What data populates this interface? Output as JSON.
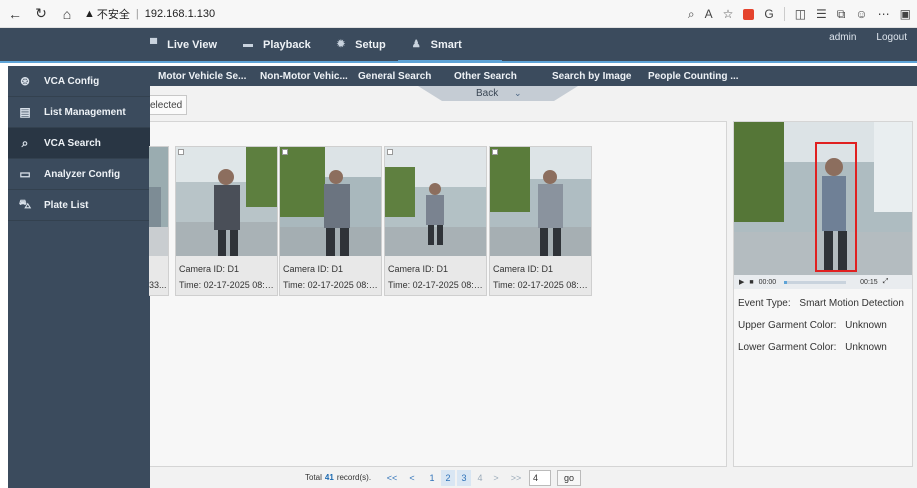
{
  "browser": {
    "security_warning": "不安全",
    "url": "192.168.1.130"
  },
  "header": {
    "menu": [
      {
        "label": "Live View",
        "icon": "monitor-icon"
      },
      {
        "label": "Playback",
        "icon": "film-icon"
      },
      {
        "label": "Setup",
        "icon": "gear-icon"
      },
      {
        "label": "Smart",
        "icon": "person-icon",
        "active": true
      }
    ],
    "user": "admin",
    "logout": "Logout"
  },
  "sidebar": {
    "items": [
      {
        "label": "VCA Config",
        "icon": "vca-config-icon"
      },
      {
        "label": "List Management",
        "icon": "list-management-icon"
      },
      {
        "label": "VCA Search",
        "icon": "search-icon",
        "active": true
      },
      {
        "label": "Analyzer Config",
        "icon": "analyzer-icon"
      },
      {
        "label": "Plate List",
        "icon": "car-icon"
      }
    ]
  },
  "search_tabs": [
    "Motor Vehicle Se...",
    "Non-Motor Vehic...",
    "General Search",
    "Other Search",
    "Search by Image",
    "People Counting ..."
  ],
  "back_tab": {
    "label": "Back"
  },
  "selected_button": "elected",
  "results": [
    {
      "camera": "",
      "time": "33..."
    },
    {
      "camera": "Camera ID: D1",
      "time": "Time: 02-17-2025 08:32..."
    },
    {
      "camera": "Camera ID: D1",
      "time": "Time: 02-17-2025 08:32..."
    },
    {
      "camera": "Camera ID: D1",
      "time": "Time: 02-17-2025 08:32..."
    },
    {
      "camera": "Camera ID: D1",
      "time": "Time: 02-17-2025 08:32..."
    }
  ],
  "detail": {
    "current_time": "00:00",
    "duration": "00:15",
    "progress": 0.05,
    "event_type_label": "Event Type:",
    "event_type_value": "Smart Motion Detection",
    "upper_label": "Upper Garment Color:",
    "upper_value": "Unknown",
    "lower_label": "Lower Garment Color:",
    "lower_value": "Unknown"
  },
  "pagination": {
    "total_prefix": "Total",
    "total_count": "41",
    "total_suffix": "record(s).",
    "first": "<<",
    "prev": "<",
    "pages": [
      "1",
      "2",
      "3",
      "4"
    ],
    "next": ">",
    "last": ">>",
    "goto_value": "4",
    "go_label": "go"
  },
  "colors": {
    "header_bg": "#3b4b5d",
    "accent": "#5ea3d6",
    "link": "#2f72b8"
  }
}
